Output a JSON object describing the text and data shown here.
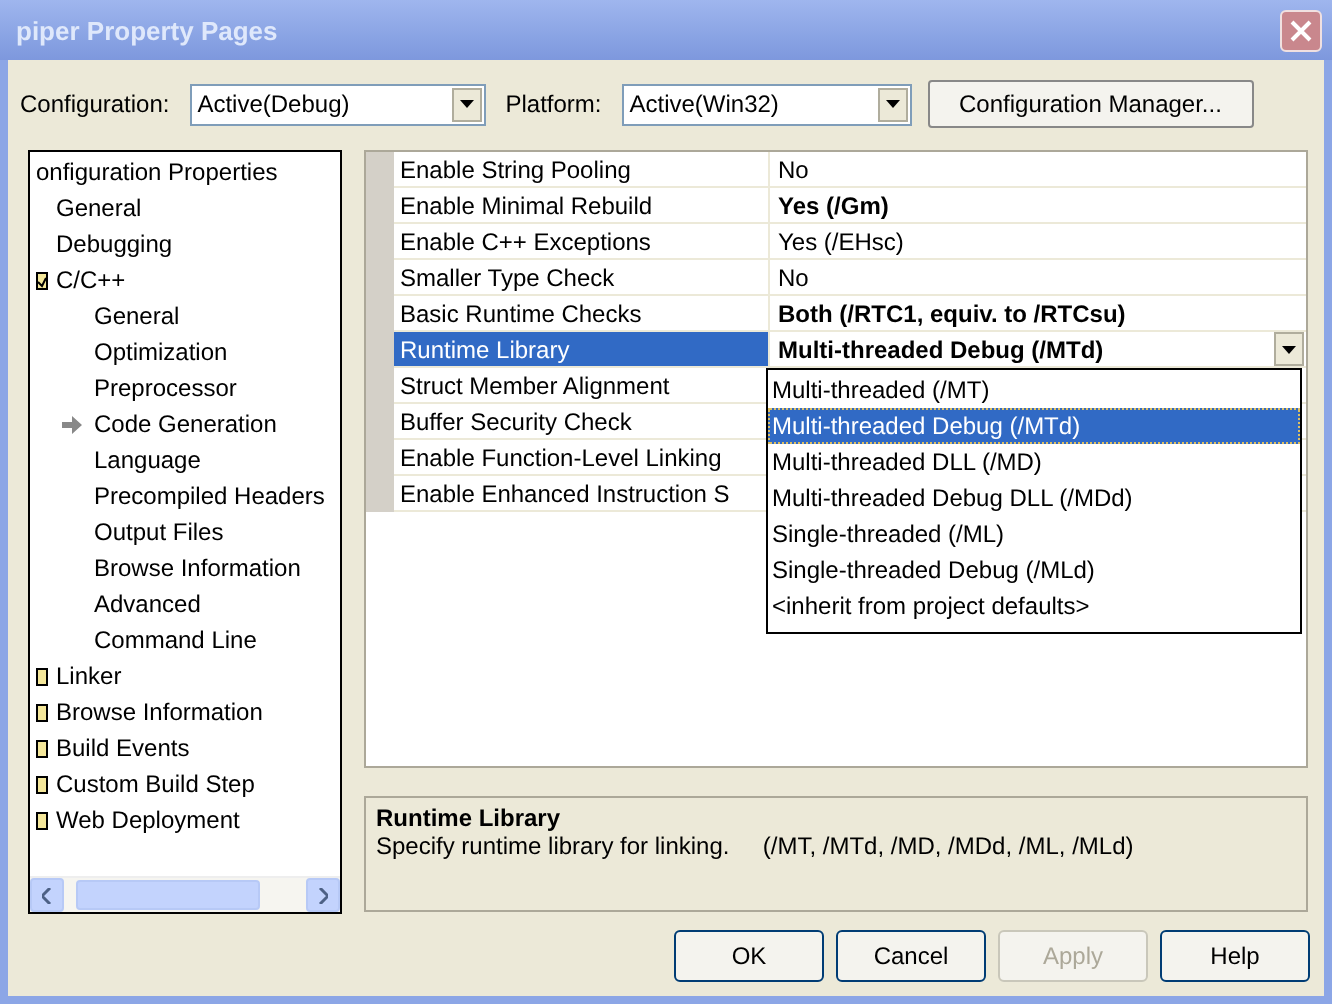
{
  "window": {
    "title": "piper Property Pages"
  },
  "toolbar": {
    "configuration": {
      "label": "Configuration:",
      "value": "Active(Debug)"
    },
    "platform": {
      "label": "Platform:",
      "value": "Active(Win32)"
    },
    "manager_button": "Configuration Manager..."
  },
  "tree": {
    "items": [
      {
        "label": "onfiguration Properties",
        "selected": false,
        "children": [
          {
            "label": "General",
            "selected": false
          },
          {
            "label": "Debugging",
            "selected": false
          },
          {
            "label": "C/C++",
            "selected": false,
            "expanded": true,
            "children": [
              {
                "label": "General",
                "selected": false
              },
              {
                "label": "Optimization",
                "selected": false
              },
              {
                "label": "Preprocessor",
                "selected": false
              },
              {
                "label": "Code Generation",
                "selected": true
              },
              {
                "label": "Language",
                "selected": false
              },
              {
                "label": "Precompiled Headers",
                "selected": false
              },
              {
                "label": "Output Files",
                "selected": false
              },
              {
                "label": "Browse Information",
                "selected": false
              },
              {
                "label": "Advanced",
                "selected": false
              },
              {
                "label": "Command Line",
                "selected": false
              }
            ]
          },
          {
            "label": "Linker",
            "selected": false,
            "expanded": false
          },
          {
            "label": "Browse Information",
            "selected": false,
            "expanded": false
          },
          {
            "label": "Build Events",
            "selected": false,
            "expanded": false
          },
          {
            "label": "Custom Build Step",
            "selected": false,
            "expanded": false
          },
          {
            "label": "Web Deployment",
            "selected": false,
            "expanded": false
          }
        ]
      }
    ]
  },
  "properties": [
    {
      "name": "Enable String Pooling",
      "value": "No",
      "modified": false,
      "selected": false
    },
    {
      "name": "Enable Minimal Rebuild",
      "value": "Yes (/Gm)",
      "modified": true,
      "selected": false
    },
    {
      "name": "Enable C++ Exceptions",
      "value": "Yes (/EHsc)",
      "modified": false,
      "selected": false
    },
    {
      "name": "Smaller Type Check",
      "value": "No",
      "modified": false,
      "selected": false
    },
    {
      "name": "Basic Runtime Checks",
      "value": "Both (/RTC1, equiv. to /RTCsu)",
      "modified": true,
      "selected": false
    },
    {
      "name": "Runtime Library",
      "value": "Multi-threaded Debug (/MTd)",
      "modified": true,
      "selected": true
    },
    {
      "name": "Struct Member Alignment",
      "selected": false
    },
    {
      "name": "Buffer Security Check",
      "selected": false
    },
    {
      "name": "Enable Function-Level Linking",
      "selected": false
    },
    {
      "name": "Enable Enhanced Instruction S",
      "selected": false
    }
  ],
  "dropdown_options": [
    {
      "label": "Multi-threaded (/MT)",
      "selected": false
    },
    {
      "label": "Multi-threaded Debug (/MTd)",
      "selected": true
    },
    {
      "label": "Multi-threaded DLL (/MD)",
      "selected": false
    },
    {
      "label": "Multi-threaded Debug DLL (/MDd)",
      "selected": false
    },
    {
      "label": "Single-threaded (/ML)",
      "selected": false
    },
    {
      "label": "Single-threaded Debug (/MLd)",
      "selected": false
    },
    {
      "label": "<inherit from project defaults>",
      "selected": false
    }
  ],
  "description": {
    "title": "Runtime Library",
    "text": "Specify runtime library for linking.     (/MT, /MTd, /MD, /MDd, /ML, /MLd)"
  },
  "buttons": [
    {
      "label": "OK",
      "disabled": false
    },
    {
      "label": "Cancel",
      "disabled": false
    },
    {
      "label": "Apply",
      "disabled": true
    },
    {
      "label": "Help",
      "disabled": false
    }
  ]
}
